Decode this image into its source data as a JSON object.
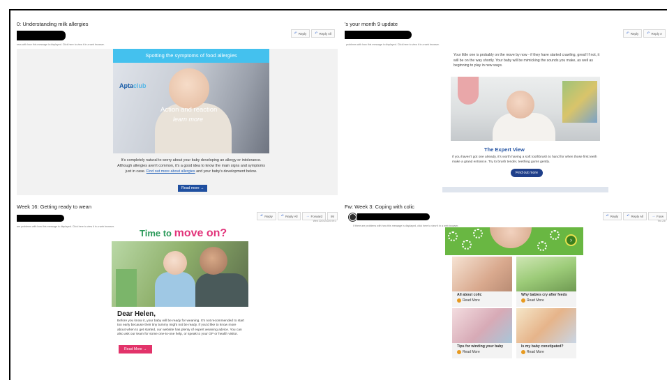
{
  "panels": {
    "p1": {
      "subject": "0: Understanding milk allergies",
      "info": "ress with how this message is displayed. Click here to view it in a web browser.",
      "actions": [
        "Reply",
        "Reply All"
      ],
      "banner": "Spotting the symptoms of food allergies",
      "logo_a": "Apta",
      "logo_b": "club",
      "hero_title": "Action and reaction",
      "hero_sub": "learn more",
      "copy_pre": "It's completely natural to worry about your baby developing an allergy or intolerance. Although allergies aren't common, it's a good idea to know the main signs and symptoms just in case.",
      "copy_link": "Find out more about allergies",
      "copy_post": "and your baby's development below.",
      "button": "Read more →"
    },
    "p2": {
      "subject": "'s your month 9 update",
      "info": "problems with how this message is displayed. Click here to view it in a web browser.",
      "actions": [
        "Reply",
        "Reply A"
      ],
      "copy1": "Your little one is probably on the move by now - if they have started crawling, great! If not, it will be on the way shortly. Your baby will be mimicking the sounds you make, as well as beginning to play in new ways.",
      "expert": "The Expert View",
      "copy2": "If you haven't got one already, it's worth having a soft toothbrush to hand for when those first teeth make a grand entrance. Try to brush tender, teething gums gently.",
      "button": "Find out more"
    },
    "p3": {
      "subject": "Week 16: Getting ready to wean",
      "info": "are problems with how this message is displayed. Click here to view it in a web browser.",
      "actions": [
        "Reply",
        "Reply All",
        "Forward",
        "IM"
      ],
      "date": "Wed 22/01/2020 09:1",
      "headline_a": "Time to ",
      "headline_b": "move on?",
      "dear": "Dear Helen,",
      "copy": "Before you know it, your baby will be ready for weaning. It's not recommended to start too early because their tiny tummy might not be ready. If you'd like to know more about when to get started, our website has plenty of expert weaning advice. You can also ask our team for some one-to-one help, or speak to your GP or health visitor.",
      "button": "Read More →"
    },
    "p4": {
      "subject": "Fw: Week 3: Coping with colic",
      "info": "If there are problems with how this message is displayed, click here to view it in a web browser.",
      "actions": [
        "Reply",
        "Reply All",
        "Forw"
      ],
      "date": "Thu 23/",
      "cards": [
        {
          "label": "All about colic",
          "more": "Read More"
        },
        {
          "label": "Why babies cry after feeds",
          "more": "Read More"
        },
        {
          "label": "Tips for winding your baby",
          "more": "Read More"
        },
        {
          "label": "Is my baby constipated?",
          "more": "Read More"
        }
      ]
    }
  },
  "colors": {
    "aptaclub_blue": "#1f4fa0",
    "banner_cyan": "#44c1ee",
    "pink": "#e2336a",
    "green": "#69b742"
  },
  "icons": [
    "reply-icon",
    "reply-all-icon",
    "forward-icon",
    "arrow-right-icon",
    "read-more-dot-icon"
  ]
}
